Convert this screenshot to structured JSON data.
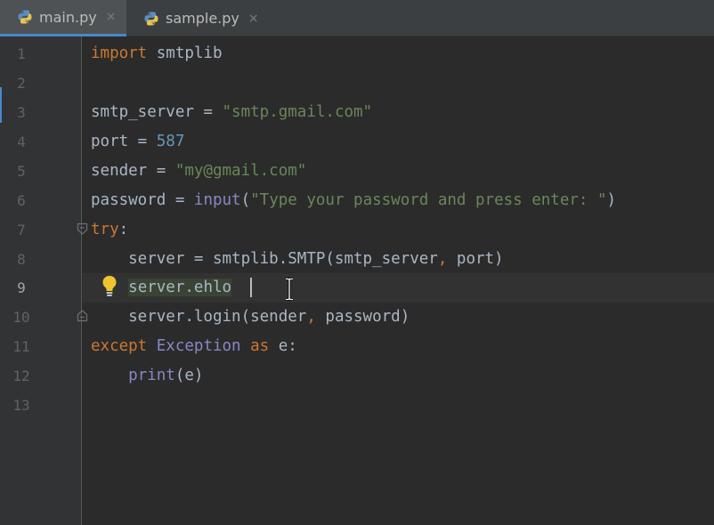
{
  "tabs": [
    {
      "label": "main.py",
      "close": "×",
      "active": true
    },
    {
      "label": "sample.py",
      "close": "×",
      "active": false
    }
  ],
  "gutter": {
    "line_numbers": [
      "1",
      "2",
      "3",
      "4",
      "5",
      "6",
      "7",
      "8",
      "9",
      "10",
      "11",
      "12",
      "13"
    ],
    "current_line": "9"
  },
  "code": {
    "l1": {
      "kw": "import",
      "rest": " smtplib"
    },
    "l3": {
      "a": "smtp_server = ",
      "s": "\"smtp.gmail.com\""
    },
    "l4": {
      "a": "port = ",
      "n": "587"
    },
    "l5": {
      "a": "sender = ",
      "s": "\"my@gmail.com\""
    },
    "l6": {
      "a": "password = ",
      "fn": "input",
      "b": "(",
      "s": "\"Type your password and press enter: \"",
      "c": ")"
    },
    "l7": {
      "kw": "try",
      "c": ":"
    },
    "l8": {
      "a": "    server = smtplib.SMTP(smtp_server",
      "comma": ",",
      "b": " port)"
    },
    "l9": {
      "indent": "    ",
      "hl": "server.ehlo"
    },
    "l10": {
      "a": "    server.login(sender",
      "comma": ",",
      "b": " password)"
    },
    "l11": {
      "kw1": "except",
      "sp": " ",
      "cls": "Exception",
      "sp2": " ",
      "kw2": "as",
      "b": " e:"
    },
    "l12": {
      "indent": "    ",
      "fn": "print",
      "b": "(e)"
    }
  },
  "colors": {
    "keyword": "#cc7832",
    "string": "#6a8759",
    "number": "#6897bb",
    "builtin": "#8888c6",
    "text": "#a9b7c6",
    "background": "#2b2b2b",
    "gutter": "#313335",
    "accent": "#4a88c7"
  },
  "icons": [
    "python-file-icon",
    "close-icon",
    "fold-icon",
    "lightbulb-icon",
    "text-cursor-icon"
  ]
}
